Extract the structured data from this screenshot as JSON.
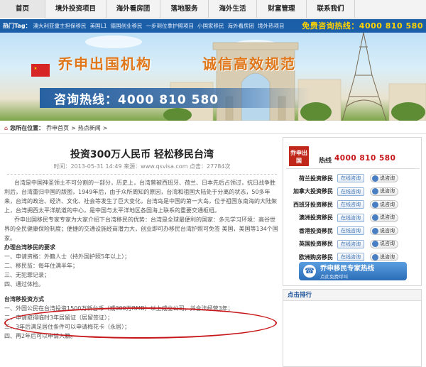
{
  "nav": {
    "items": [
      "首页",
      "境外投资项目",
      "海外看房团",
      "落地服务",
      "海外生活",
      "财富管理",
      "联系我们"
    ]
  },
  "tagbar": {
    "label": "热门Tag：",
    "tags": [
      "澳大利亚重主担保移民",
      "美国L1",
      "德国创业移民",
      "一步到位拿护照项目",
      "小国家移民",
      "海外看房团",
      "境外热项目"
    ],
    "hotline": "免费咨询热线：4000 810 580"
  },
  "banner": {
    "slogan_left": "乔申出国机构",
    "slogan_right": "诚信高效规范",
    "phone": "咨询热线：4000 810 580"
  },
  "breadcrumb": {
    "prefix": "您所在位置：",
    "home": "乔申首页",
    "sep1": ">",
    "current": "热点新闻",
    "sep2": ">"
  },
  "article": {
    "title": "投资300万人民币 轻松移民台湾",
    "meta": "时间：2013-05-31 14:49   来源：www.qsvisa.com   点击：27784次",
    "paragraphs": [
      "台湾是中国神圣领土不可分割的一部分，历史上，台湾曾被西班牙、荷兰、日本先后占领过，抗日战争胜利后，台湾重归中国的版图，1949年后，由于众所周知的原因，台湾和祖国大陆处于分离的状态，50多年来，台湾的政治、经济、文化、社会等发生了巨大变化，台湾岛是中国的第一大岛，位于祖国东南海的大陆架上，台湾拥西太平洋航道的中心，是中国与太平洋地区各国海上联系的重要交通枢纽。",
      "乔申出国移民专家专家为大家介绍下台湾移民的优势：台湾是全球最便利的国家：多元学习环境：高谷世界的全民健康保险制度；便捷的交通设施经商潜力大，创业即可办移民台湾护照可免签 美国，美国等134个国家。"
    ],
    "link_text": "台湾移民的",
    "section1_title": "办理台湾移民的要求",
    "section1_items": [
      "一、申请资格：外籍人士（持外国护照5年以上）；",
      "二、移民监：每年住满半年；",
      "三、无犯罪记录；",
      "四、通过体检。"
    ],
    "section2_title": "台湾移投资方式",
    "section2_items": [
      "一、外国公民在台湾投资1500万新台币（或300万RMB）以上成立公司，并合法经营3年；",
      "二、申请取得临时3年居留证（居留签证）；",
      "三、3年后满足居住条件可以申请梅花卡（永居）；",
      "四、再2年后可以申请入籍。"
    ]
  },
  "sidebar": {
    "logo": "乔申出国",
    "hot_label": "热线",
    "hot_number": "4000 810 580",
    "rows": [
      {
        "name": "荷兰投资移民",
        "btn": "在线咨询",
        "ask": "说咨询"
      },
      {
        "name": "加拿大投资移民",
        "btn": "在线咨询",
        "ask": "说咨询"
      },
      {
        "name": "西班牙投资移民",
        "btn": "在线咨询",
        "ask": "说咨询"
      },
      {
        "name": "澳洲投资移民",
        "btn": "在线咨询",
        "ask": "说咨询"
      },
      {
        "name": "香港投资移民",
        "btn": "在线咨询",
        "ask": "说咨询"
      },
      {
        "name": "英国投资移民",
        "btn": "在线咨询",
        "ask": "说咨询"
      },
      {
        "name": "欧洲购房移民",
        "btn": "在线咨询",
        "ask": "说咨询"
      }
    ],
    "hotline_btn_main": "乔申移民专家热线",
    "hotline_btn_sub": "点此免费呼叫",
    "ranking_title": "点击排行"
  }
}
